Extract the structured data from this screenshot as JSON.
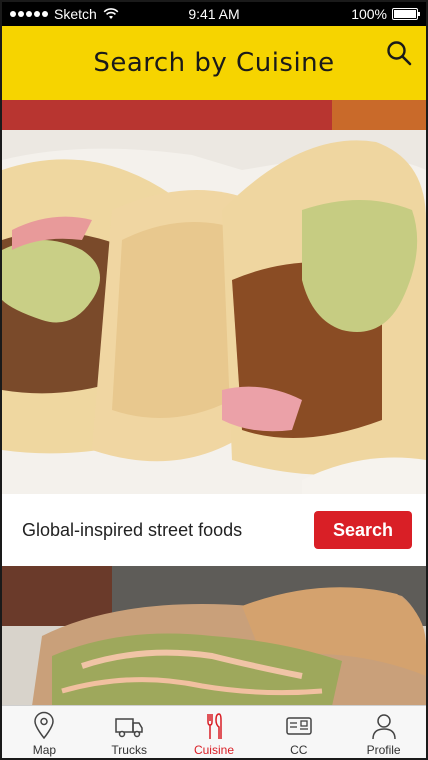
{
  "status_bar": {
    "carrier": "Sketch",
    "time": "9:41 AM",
    "battery": "100%"
  },
  "header": {
    "title": "Search by Cuisine",
    "search_icon": "search-icon"
  },
  "hero": {
    "image": "tacos-photo"
  },
  "caption": {
    "text": "Global-inspired street foods",
    "button_label": "Search"
  },
  "second_image": {
    "image": "sandwich-photo"
  },
  "tabs": [
    {
      "label": "Map",
      "icon": "map-pin-icon",
      "active": false
    },
    {
      "label": "Trucks",
      "icon": "truck-icon",
      "active": false
    },
    {
      "label": "Cuisine",
      "icon": "fork-knife-icon",
      "active": true
    },
    {
      "label": "CC",
      "icon": "card-icon",
      "active": false
    },
    {
      "label": "Profile",
      "icon": "profile-icon",
      "active": false
    }
  ],
  "colors": {
    "header_bg": "#f6d400",
    "accent": "#d91f26",
    "status_bg": "#000000"
  }
}
